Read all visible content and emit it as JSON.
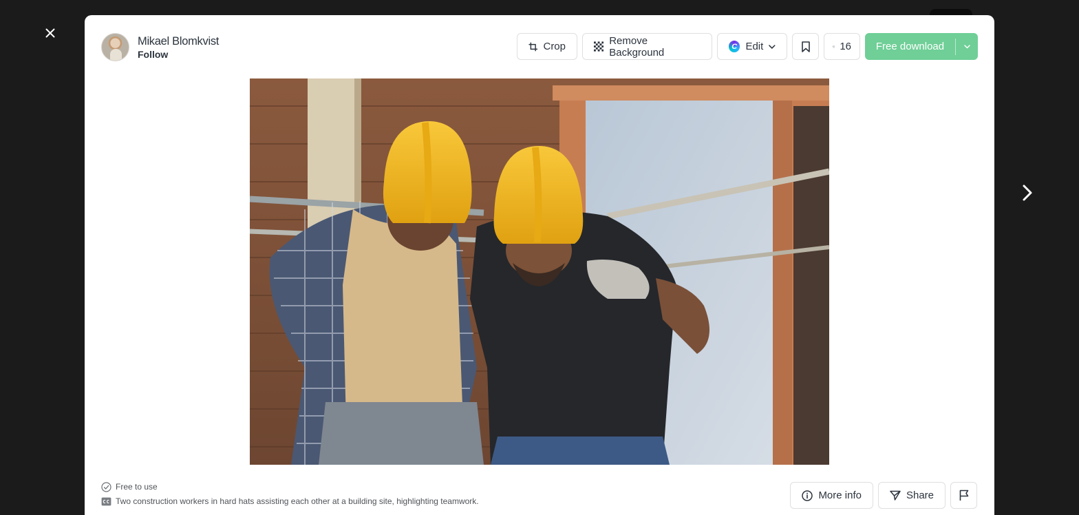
{
  "author": {
    "name": "Mikael Blomkvist",
    "follow_label": "Follow"
  },
  "toolbar": {
    "crop_label": "Crop",
    "remove_bg_label": "Remove Background",
    "edit_label": "Edit",
    "like_count": "16",
    "download_label": "Free download"
  },
  "photo": {
    "subject": "Two construction workers in hard hats assisting each other at a building site"
  },
  "meta": {
    "license_label": "Free to use",
    "caption": "Two construction workers in hard hats assisting each other at a building site, highlighting teamwork."
  },
  "bottom_actions": {
    "more_info_label": "More info",
    "share_label": "Share"
  },
  "colors": {
    "backdrop": "#1b1b1b",
    "download_green": "#6fcf97",
    "text_dark": "#2c343e",
    "hard_hat_yellow": "#f2b71f"
  }
}
